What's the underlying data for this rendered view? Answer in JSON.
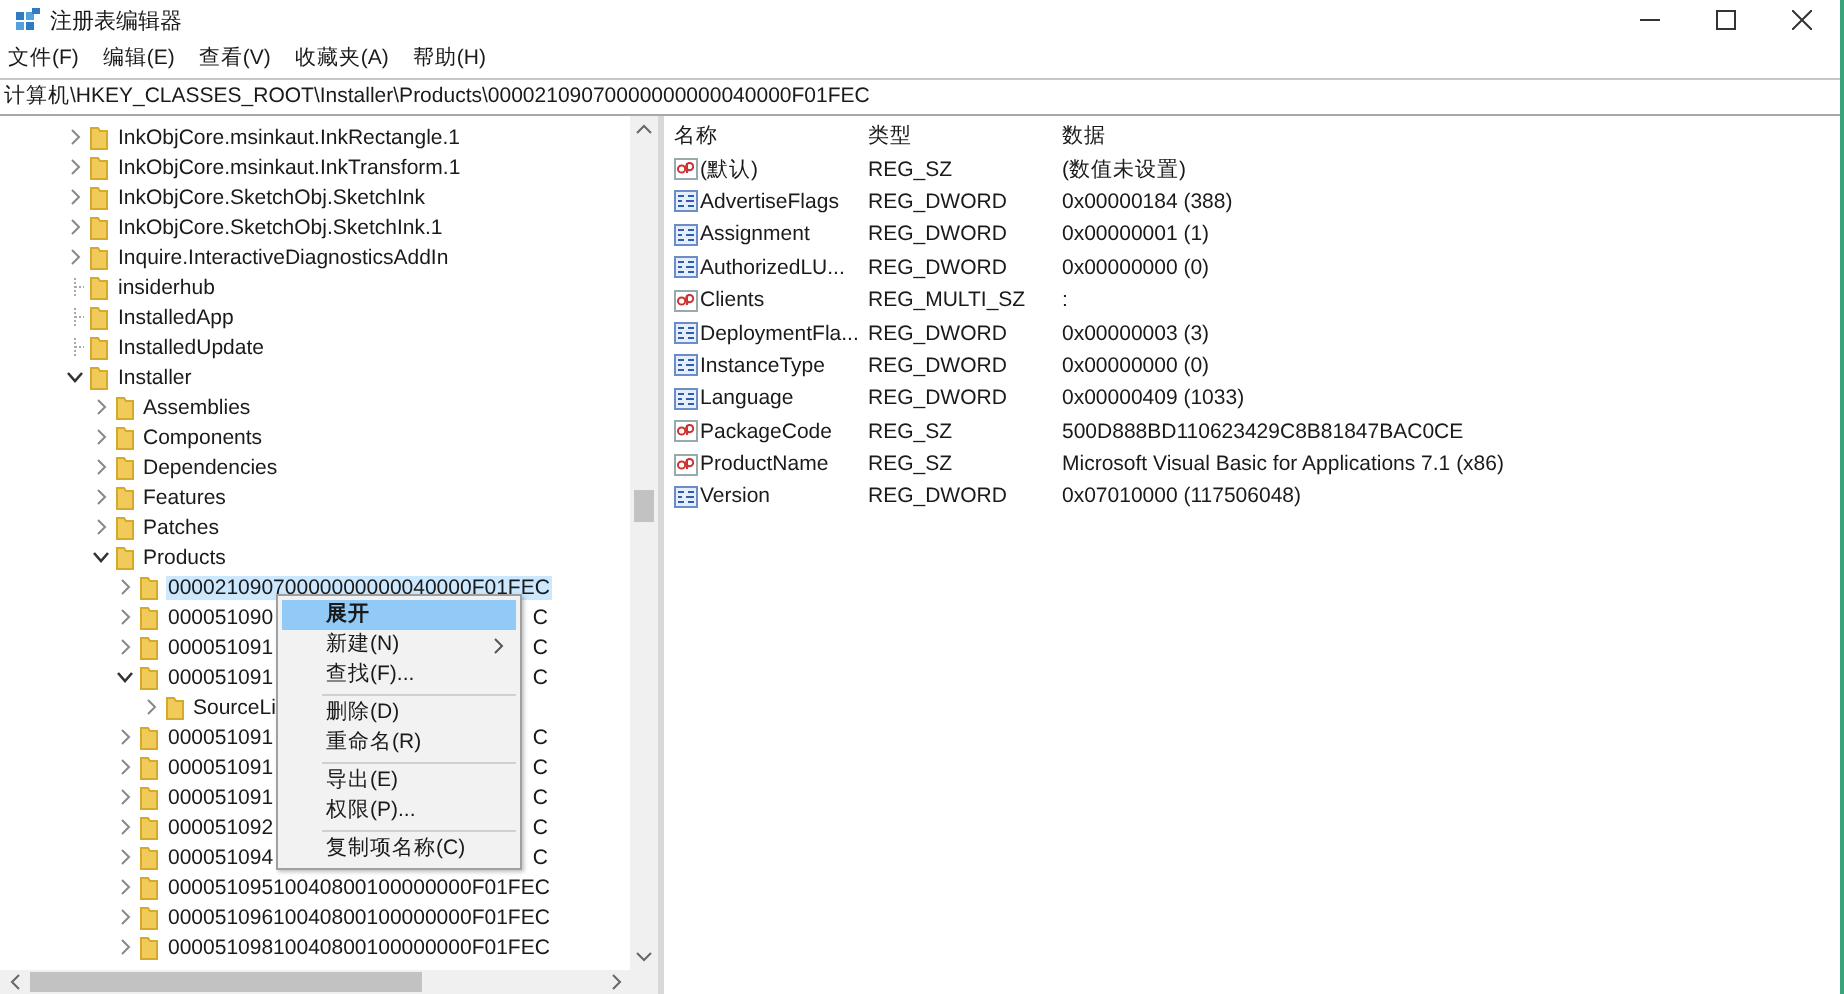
{
  "window": {
    "title": "注册表编辑器"
  },
  "menu": [
    "文件(F)",
    "编辑(E)",
    "查看(V)",
    "收藏夹(A)",
    "帮助(H)"
  ],
  "address": "计算机\\HKEY_CLASSES_ROOT\\Installer\\Products\\00002109070000000000040000F01FEC",
  "tree": [
    {
      "label": "InkObjCore.msinkaut.InkRectangle.1",
      "kind": "branch",
      "expanded": false,
      "selected": false
    },
    {
      "label": "InkObjCore.msinkaut.InkTransform.1",
      "kind": "branch",
      "expanded": false,
      "selected": false
    },
    {
      "label": "InkObjCore.SketchObj.SketchInk",
      "kind": "branch",
      "expanded": false,
      "selected": false
    },
    {
      "label": "InkObjCore.SketchObj.SketchInk.1",
      "kind": "branch",
      "expanded": false,
      "selected": false
    },
    {
      "label": "Inquire.InteractiveDiagnosticsAddIn",
      "kind": "branch",
      "expanded": false,
      "selected": false
    },
    {
      "label": "insiderhub",
      "kind": "leaf",
      "selected": false
    },
    {
      "label": "InstalledApp",
      "kind": "leaf",
      "selected": false
    },
    {
      "label": "InstalledUpdate",
      "kind": "leaf",
      "selected": false
    },
    {
      "label": "Installer",
      "kind": "branch",
      "expanded": true,
      "selected": false,
      "children": [
        {
          "label": "Assemblies",
          "kind": "branch",
          "expanded": false,
          "selected": false
        },
        {
          "label": "Components",
          "kind": "branch",
          "expanded": false,
          "selected": false
        },
        {
          "label": "Dependencies",
          "kind": "branch",
          "expanded": false,
          "selected": false
        },
        {
          "label": "Features",
          "kind": "branch",
          "expanded": false,
          "selected": false
        },
        {
          "label": "Patches",
          "kind": "branch",
          "expanded": false,
          "selected": false
        },
        {
          "label": "Products",
          "kind": "branch",
          "expanded": true,
          "selected": false,
          "children": [
            {
              "label": "00002109070000000000040000F01FEC",
              "kind": "branch",
              "expanded": false,
              "selected": true
            },
            {
              "label": "000051090",
              "tail": "C",
              "kind": "branch",
              "expanded": false,
              "selected": false
            },
            {
              "label": "000051091",
              "tail": "C",
              "kind": "branch",
              "expanded": false,
              "selected": false
            },
            {
              "label": "000051091",
              "tail": "C",
              "kind": "branch",
              "expanded": true,
              "selected": false,
              "children": [
                {
                  "label": "SourceLi",
                  "kind": "branch",
                  "expanded": false,
                  "selected": false
                }
              ]
            },
            {
              "label": "000051091",
              "tail": "C",
              "kind": "branch",
              "expanded": false,
              "selected": false
            },
            {
              "label": "000051091",
              "tail": "C",
              "kind": "branch",
              "expanded": false,
              "selected": false
            },
            {
              "label": "000051091",
              "tail": "C",
              "kind": "branch",
              "expanded": false,
              "selected": false
            },
            {
              "label": "000051092",
              "tail": "C",
              "kind": "branch",
              "expanded": false,
              "selected": false
            },
            {
              "label": "000051094",
              "tail": "C",
              "kind": "branch",
              "expanded": false,
              "selected": false
            },
            {
              "label": "00005109510040800100000000F01FEC",
              "kind": "branch",
              "expanded": false,
              "selected": false
            },
            {
              "label": "00005109610040800100000000F01FEC",
              "kind": "branch",
              "expanded": false,
              "selected": false
            },
            {
              "label": "00005109810040800100000000F01FEC",
              "kind": "branch",
              "expanded": false,
              "selected": false
            }
          ]
        }
      ]
    }
  ],
  "values": {
    "columns": [
      "名称",
      "类型",
      "数据"
    ],
    "rows": [
      {
        "kind": "string",
        "name": "(默认)",
        "type": "REG_SZ",
        "data": "(数值未设置)"
      },
      {
        "kind": "binary",
        "name": "AdvertiseFlags",
        "type": "REG_DWORD",
        "data": "0x00000184 (388)"
      },
      {
        "kind": "binary",
        "name": "Assignment",
        "type": "REG_DWORD",
        "data": "0x00000001 (1)"
      },
      {
        "kind": "binary",
        "name": "AuthorizedLU...",
        "type": "REG_DWORD",
        "data": "0x00000000 (0)"
      },
      {
        "kind": "string",
        "name": "Clients",
        "type": "REG_MULTI_SZ",
        "data": ":"
      },
      {
        "kind": "binary",
        "name": "DeploymentFla...",
        "type": "REG_DWORD",
        "data": "0x00000003 (3)"
      },
      {
        "kind": "binary",
        "name": "InstanceType",
        "type": "REG_DWORD",
        "data": "0x00000000 (0)"
      },
      {
        "kind": "binary",
        "name": "Language",
        "type": "REG_DWORD",
        "data": "0x00000409 (1033)"
      },
      {
        "kind": "string",
        "name": "PackageCode",
        "type": "REG_SZ",
        "data": "500D888BD110623429C8B81847BAC0CE"
      },
      {
        "kind": "string",
        "name": "ProductName",
        "type": "REG_SZ",
        "data": "Microsoft Visual Basic for Applications 7.1 (x86)"
      },
      {
        "kind": "binary",
        "name": "Version",
        "type": "REG_DWORD",
        "data": "0x07010000 (117506048)"
      }
    ]
  },
  "context_menu": [
    {
      "kind": "item",
      "label": "展开",
      "bold": true,
      "selected": true,
      "submenu": false
    },
    {
      "kind": "item",
      "label": "新建(N)",
      "bold": false,
      "selected": false,
      "submenu": true
    },
    {
      "kind": "item",
      "label": "查找(F)...",
      "bold": false,
      "selected": false,
      "submenu": false
    },
    {
      "kind": "separator"
    },
    {
      "kind": "item",
      "label": "删除(D)",
      "bold": false,
      "selected": false,
      "submenu": false
    },
    {
      "kind": "item",
      "label": "重命名(R)",
      "bold": false,
      "selected": false,
      "submenu": false
    },
    {
      "kind": "separator"
    },
    {
      "kind": "item",
      "label": "导出(E)",
      "bold": false,
      "selected": false,
      "submenu": false
    },
    {
      "kind": "item",
      "label": "权限(P)...",
      "bold": false,
      "selected": false,
      "submenu": false
    },
    {
      "kind": "separator"
    },
    {
      "kind": "item",
      "label": "复制项名称(C)",
      "bold": false,
      "selected": false,
      "submenu": false
    }
  ]
}
